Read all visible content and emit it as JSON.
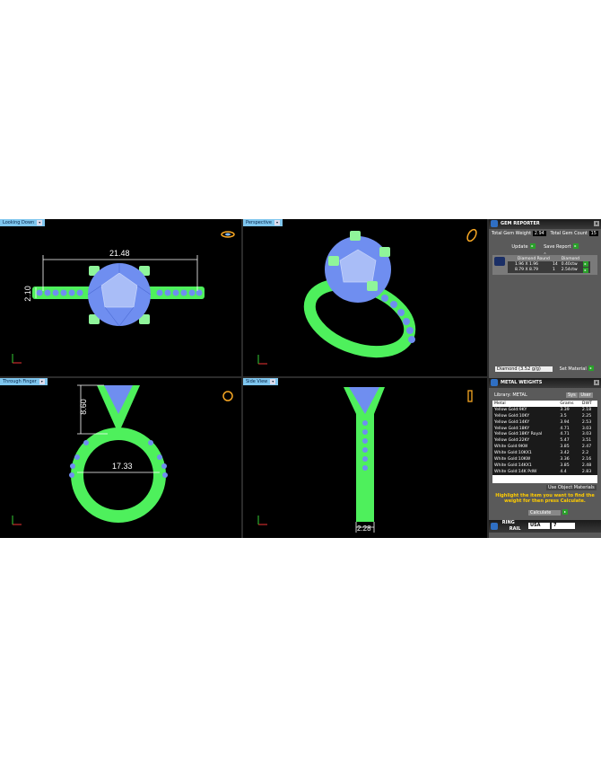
{
  "viewports": {
    "top_left": {
      "label": "Looking Down",
      "dim_width": "21.48",
      "dim_height": "2.10"
    },
    "top_right": {
      "label": "Perspective"
    },
    "bottom_left": {
      "label": "Through Finger",
      "dim_height": "8.60",
      "dim_inner": "17.33"
    },
    "bottom_right": {
      "label": "Side View",
      "dim_width": "2.28"
    }
  },
  "gem_reporter": {
    "title": "GEM REPORTER",
    "total_weight_label": "Total Gem Weight",
    "total_weight_value": "2.94",
    "total_count_label": "Total Gem Count",
    "total_count_value": "15",
    "update_label": "Update",
    "save_label": "Save Report",
    "col_shape": "Diamond Round",
    "col_material": "Diamond",
    "rows": [
      {
        "size": "1.96 X 1.96",
        "count": "14",
        "weight": "0.40ctw"
      },
      {
        "size": "8.79 X 8.79",
        "count": "1",
        "weight": "2.54ctw"
      }
    ],
    "material_select": "Diamond   (3.52 g/g)",
    "set_material_label": "Set Material"
  },
  "metal_weights": {
    "title": "METAL WEIGHTS",
    "library_label": "Library: METAL",
    "sys_label": "Sys",
    "user_label": "User",
    "col_metal": "Metal",
    "col_grams": "Grams",
    "col_dwt": "DWT",
    "rows": [
      {
        "metal": "Yellow Gold:9KY",
        "grams": "3.39",
        "dwt": "2.18"
      },
      {
        "metal": "Yellow Gold:10KY",
        "grams": "3.5",
        "dwt": "2.25"
      },
      {
        "metal": "Yellow Gold:14KY",
        "grams": "3.94",
        "dwt": "2.53"
      },
      {
        "metal": "Yellow Gold:18KY",
        "grams": "4.71",
        "dwt": "3.03"
      },
      {
        "metal": "Yellow Gold:18KY Royal",
        "grams": "4.71",
        "dwt": "3.03"
      },
      {
        "metal": "Yellow Gold:22KY",
        "grams": "5.47",
        "dwt": "3.51"
      },
      {
        "metal": "White Gold:9KW",
        "grams": "3.85",
        "dwt": "2.47"
      },
      {
        "metal": "White Gold:10KX1",
        "grams": "3.42",
        "dwt": "2.2"
      },
      {
        "metal": "White Gold:10KW",
        "grams": "3.36",
        "dwt": "2.16"
      },
      {
        "metal": "White Gold:14KX1",
        "grams": "3.85",
        "dwt": "2.48"
      },
      {
        "metal": "White Gold:14K PdW",
        "grams": "4.4",
        "dwt": "2.83"
      }
    ],
    "use_object_label": "Use Object Materials",
    "hint": "Highlight the item you want to find the weight for then press Calculate.",
    "calculate_label": "Calculate"
  },
  "ring_rail": {
    "title_1": "RING",
    "title_2": "RAIL",
    "region": "USA",
    "size": "7"
  },
  "colors": {
    "metal_green": "#4ef05c",
    "gem_blue": "#6f8ef0",
    "viewport_bg": "#000000",
    "highlight": "#ffcc00"
  }
}
